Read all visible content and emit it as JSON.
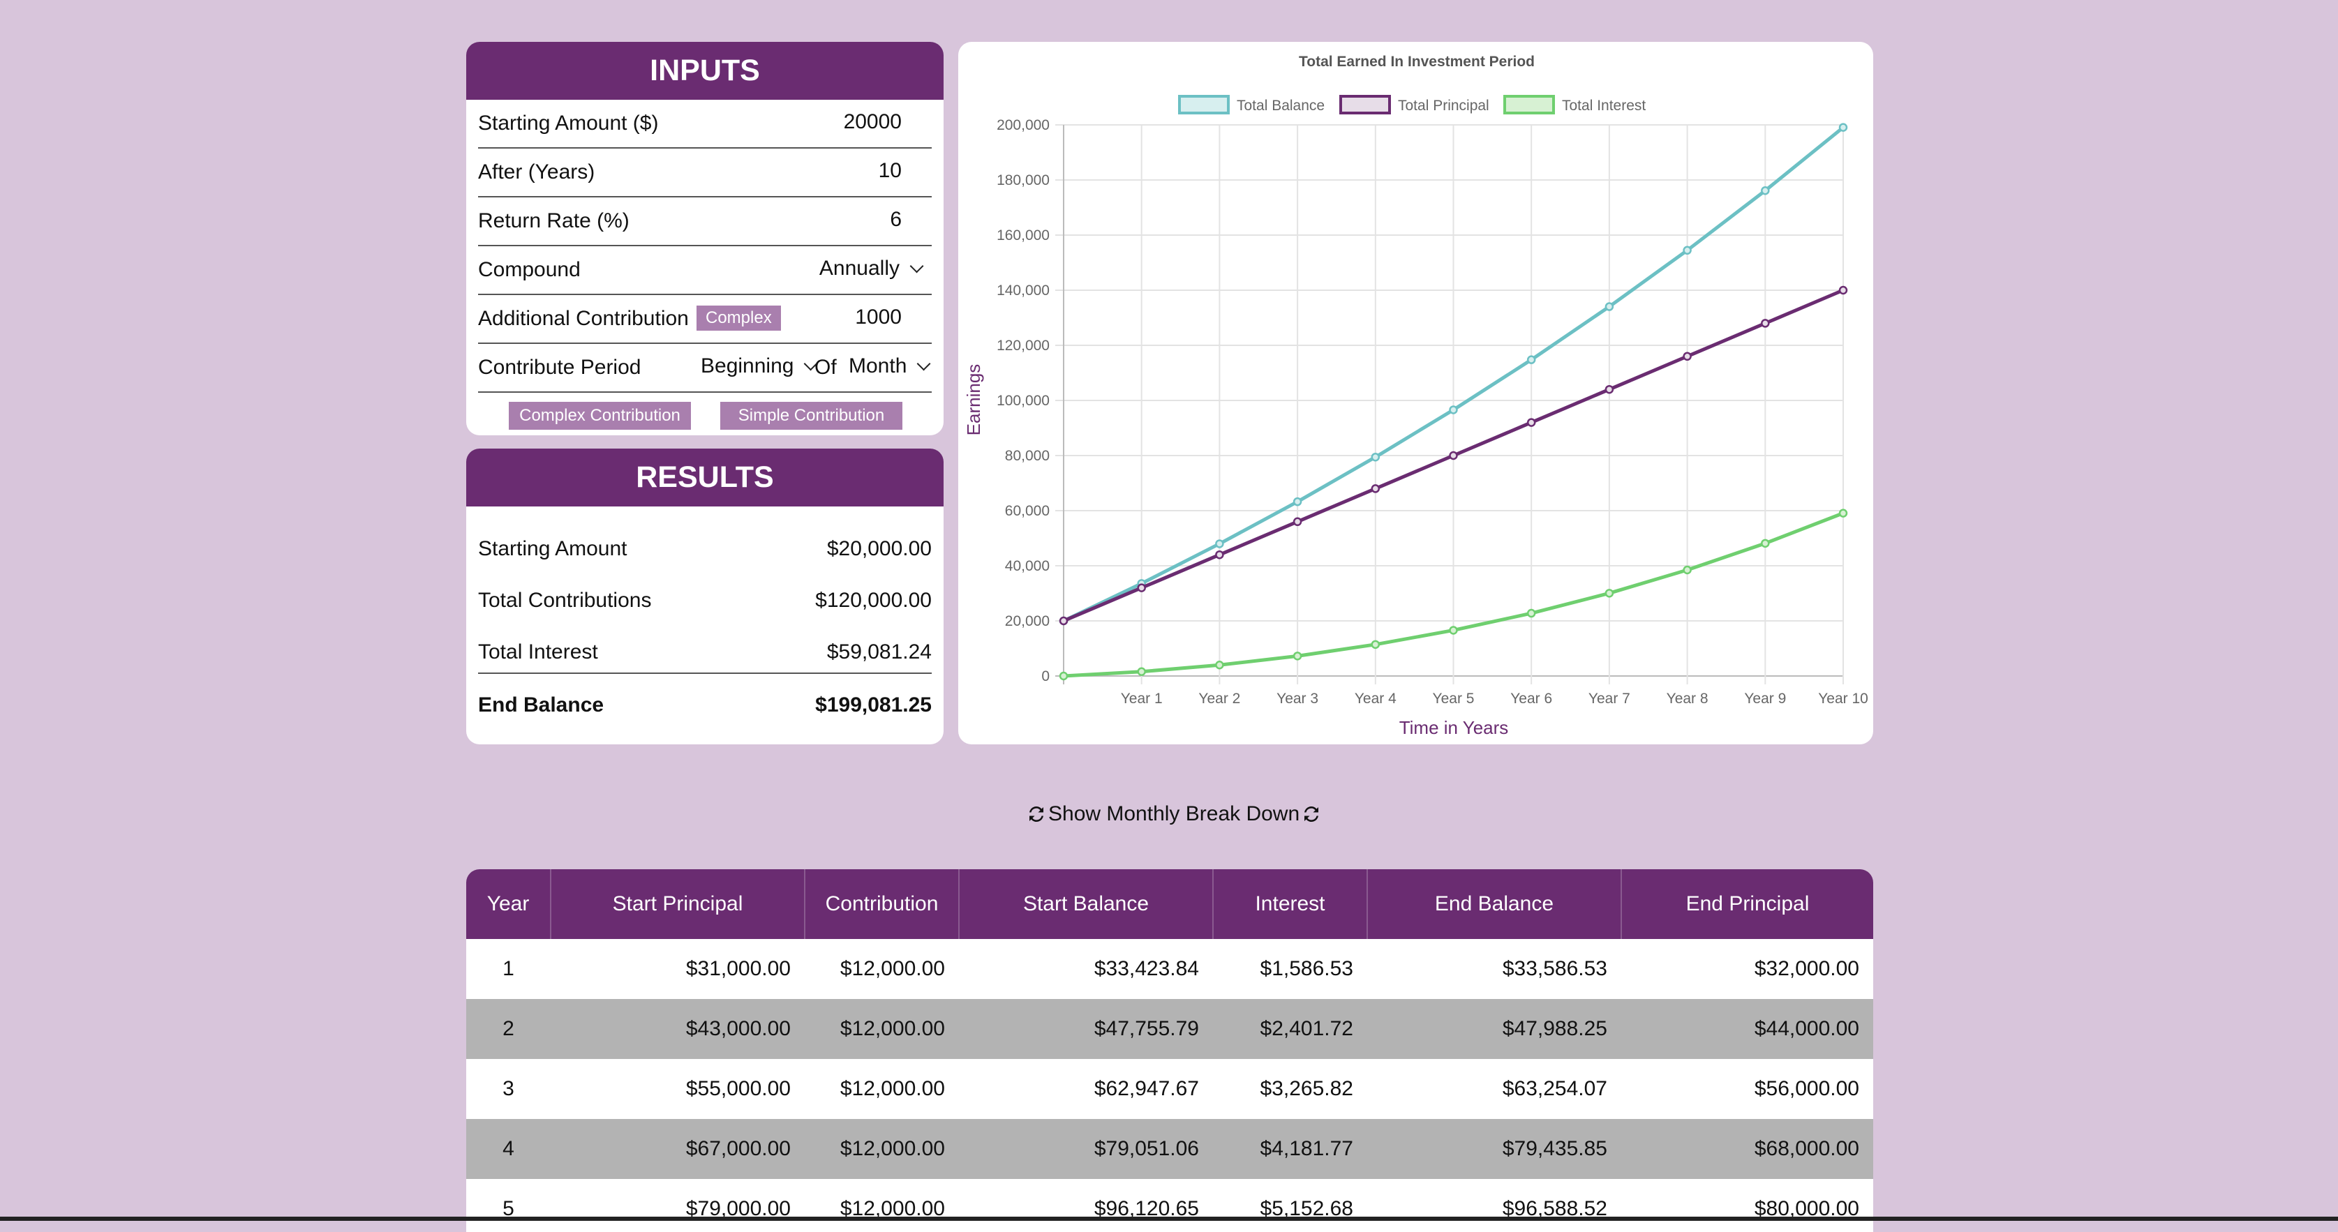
{
  "inputs": {
    "title": "INPUTS",
    "starting_amount_label": "Starting Amount ($)",
    "starting_amount_value": "20000",
    "years_label": "After (Years)",
    "years_value": "10",
    "rate_label": "Return Rate (%)",
    "rate_value": "6",
    "compound_label": "Compound",
    "compound_value": "Annually",
    "contribution_label": "Additional Contribution",
    "contribution_tag": "Complex",
    "contribution_value": "1000",
    "period_label": "Contribute Period",
    "period_value": "Beginning",
    "period_of": "Of",
    "period_unit": "Month",
    "complex_button": "Complex Contribution",
    "simple_button": "Simple Contribution"
  },
  "results": {
    "title": "RESULTS",
    "rows": [
      {
        "label": "Starting Amount",
        "value": "$20,000.00"
      },
      {
        "label": "Total Contributions",
        "value": "$120,000.00"
      },
      {
        "label": "Total Interest",
        "value": "$59,081.24"
      },
      {
        "label": "End Balance",
        "value": "$199,081.25"
      }
    ]
  },
  "toggle": {
    "label": "Show Monthly Break Down"
  },
  "table": {
    "headers": [
      "Year",
      "Start Principal",
      "Contribution",
      "Start Balance",
      "Interest",
      "End Balance",
      "End Principal"
    ],
    "rows": [
      [
        "1",
        "$31,000.00",
        "$12,000.00",
        "$33,423.84",
        "$1,586.53",
        "$33,586.53",
        "$32,000.00"
      ],
      [
        "2",
        "$43,000.00",
        "$12,000.00",
        "$47,755.79",
        "$2,401.72",
        "$47,988.25",
        "$44,000.00"
      ],
      [
        "3",
        "$55,000.00",
        "$12,000.00",
        "$62,947.67",
        "$3,265.82",
        "$63,254.07",
        "$56,000.00"
      ],
      [
        "4",
        "$67,000.00",
        "$12,000.00",
        "$79,051.06",
        "$4,181.77",
        "$79,435.85",
        "$68,000.00"
      ],
      [
        "5",
        "$79,000.00",
        "$12,000.00",
        "$96,120.65",
        "$5,152.68",
        "$96,588.52",
        "$80,000.00"
      ]
    ]
  },
  "chart_data": {
    "type": "line",
    "title": "Total Earned In Investment Period",
    "xlabel": "Time in Years",
    "ylabel": "Earnings",
    "x": [
      "",
      "Year 1",
      "Year 2",
      "Year 3",
      "Year 4",
      "Year 5",
      "Year 6",
      "Year 7",
      "Year 8",
      "Year 9",
      "Year 10"
    ],
    "ylim": [
      0,
      200000
    ],
    "yticks": [
      "0",
      "20,000",
      "40,000",
      "60,000",
      "80,000",
      "100,000",
      "120,000",
      "140,000",
      "160,000",
      "180,000",
      "200,000"
    ],
    "grid": true,
    "legend_position": "top",
    "series": [
      {
        "name": "Total Balance",
        "color": "#6cc0c4",
        "fill": "#d7efef",
        "values": [
          20000,
          33586.53,
          47988.25,
          63254.07,
          79435.85,
          96588.52,
          114770,
          134046,
          154480,
          176140,
          199081.25
        ]
      },
      {
        "name": "Total Principal",
        "color": "#6a2c71",
        "fill": "#e7dde8",
        "values": [
          20000,
          32000,
          44000,
          56000,
          68000,
          80000,
          92000,
          104000,
          116000,
          128000,
          140000
        ]
      },
      {
        "name": "Total Interest",
        "color": "#6fcf6f",
        "fill": "#d7f1d3",
        "values": [
          0,
          1586.53,
          3988.25,
          7254.07,
          11435.85,
          16588.52,
          22770,
          30046,
          38480,
          48140,
          59081.24
        ]
      }
    ]
  }
}
